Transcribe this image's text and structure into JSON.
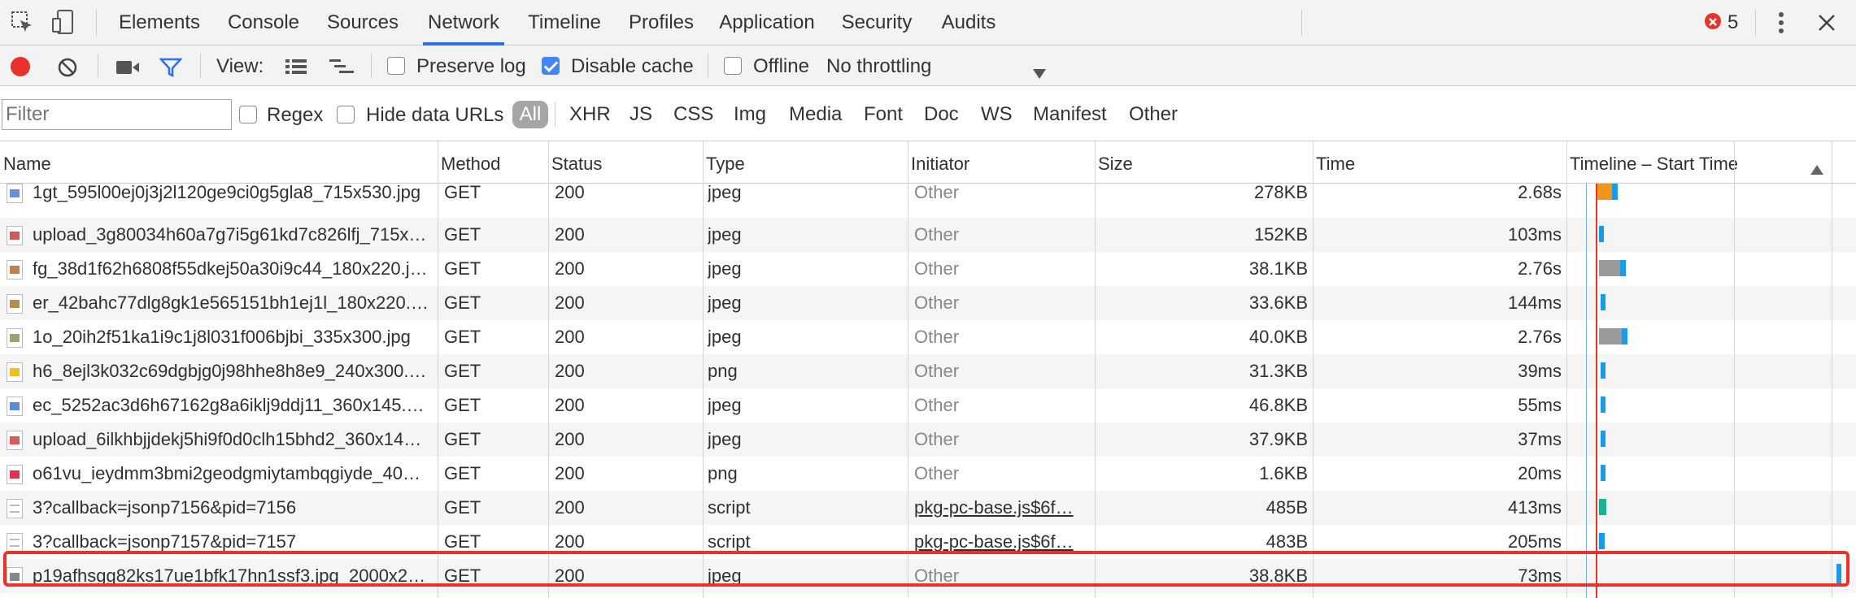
{
  "toolbar_tabs": [
    "Elements",
    "Console",
    "Sources",
    "Network",
    "Timeline",
    "Profiles",
    "Application",
    "Security",
    "Audits"
  ],
  "active_tab": "Network",
  "error_count": "5",
  "controls": {
    "view_label": "View:",
    "preserve_log": "Preserve log",
    "preserve_log_checked": false,
    "disable_cache": "Disable cache",
    "disable_cache_checked": true,
    "offline": "Offline",
    "offline_checked": false,
    "throttling": "No throttling"
  },
  "filter": {
    "placeholder": "Filter",
    "regex": "Regex",
    "hide_data_urls": "Hide data URLs",
    "types": [
      "All",
      "XHR",
      "JS",
      "CSS",
      "Img",
      "Media",
      "Font",
      "Doc",
      "WS",
      "Manifest",
      "Other"
    ]
  },
  "columns": [
    "Name",
    "Method",
    "Status",
    "Type",
    "Initiator",
    "Size",
    "Time",
    "Timeline – Start Time"
  ],
  "colors": {
    "accent": "#2c70ea",
    "record": "#e8322c",
    "highlight": "#e8322c",
    "bar_blue": "#1a9be8",
    "bar_orange": "#f0961c",
    "bar_gray": "#9a9a9a"
  },
  "rows": [
    {
      "name": "1gt_595l00ej0j3j2l120ge9ci0g5gla8_715x530.jpg",
      "method": "GET",
      "status": "200",
      "type": "jpeg",
      "initiator": "Other",
      "initiator_link": false,
      "size": "278KB",
      "time": "2.68s",
      "icon": "image-thumb-icon"
    },
    {
      "name": "upload_3g80034h60a7g7i5g61kd7c826lfj_715x…",
      "method": "GET",
      "status": "200",
      "type": "jpeg",
      "initiator": "Other",
      "initiator_link": false,
      "size": "152KB",
      "time": "103ms",
      "icon": "image-thumb-icon"
    },
    {
      "name": "fg_38d1f62h6808f55dkej50a30i9c44_180x220.j…",
      "method": "GET",
      "status": "200",
      "type": "jpeg",
      "initiator": "Other",
      "initiator_link": false,
      "size": "38.1KB",
      "time": "2.76s",
      "icon": "image-thumb-icon"
    },
    {
      "name": "er_42bahc77dlg8gk1e565151bh1ej1l_180x220.…",
      "method": "GET",
      "status": "200",
      "type": "jpeg",
      "initiator": "Other",
      "initiator_link": false,
      "size": "33.6KB",
      "time": "144ms",
      "icon": "image-thumb-icon"
    },
    {
      "name": "1o_20ih2f51ka1i9c1j8l031f006bjbi_335x300.jpg",
      "method": "GET",
      "status": "200",
      "type": "jpeg",
      "initiator": "Other",
      "initiator_link": false,
      "size": "40.0KB",
      "time": "2.76s",
      "icon": "image-thumb-icon"
    },
    {
      "name": "h6_8ejl3k032c69dgbjg0j98hhe8h8e9_240x300.…",
      "method": "GET",
      "status": "200",
      "type": "png",
      "initiator": "Other",
      "initiator_link": false,
      "size": "31.3KB",
      "time": "39ms",
      "icon": "image-thumb-icon"
    },
    {
      "name": "ec_5252ac3d6h67162g8a6iklj9ddj11_360x145.…",
      "method": "GET",
      "status": "200",
      "type": "jpeg",
      "initiator": "Other",
      "initiator_link": false,
      "size": "46.8KB",
      "time": "55ms",
      "icon": "image-thumb-icon"
    },
    {
      "name": "upload_6ilkhbjjdekj5hi9f0d0clh15bhd2_360x14…",
      "method": "GET",
      "status": "200",
      "type": "jpeg",
      "initiator": "Other",
      "initiator_link": false,
      "size": "37.9KB",
      "time": "37ms",
      "icon": "image-thumb-icon"
    },
    {
      "name": "o61vu_ieydmm3bmi2geodgmiytambqgiyde_40…",
      "method": "GET",
      "status": "200",
      "type": "png",
      "initiator": "Other",
      "initiator_link": false,
      "size": "1.6KB",
      "time": "20ms",
      "icon": "image-thumb-icon"
    },
    {
      "name": "3?callback=jsonp7156&pid=7156",
      "method": "GET",
      "status": "200",
      "type": "script",
      "initiator": "pkg-pc-base.js$6f…",
      "initiator_link": true,
      "size": "485B",
      "time": "413ms",
      "icon": "script-file-icon"
    },
    {
      "name": "3?callback=jsonp7157&pid=7157",
      "method": "GET",
      "status": "200",
      "type": "script",
      "initiator": "pkg-pc-base.js$6f…",
      "initiator_link": true,
      "size": "483B",
      "time": "205ms",
      "icon": "script-file-icon"
    },
    {
      "name": "p19afhsgg82ks17ue1bfk17hn1ssf3.jpg_2000x2…",
      "method": "GET",
      "status": "200",
      "type": "jpeg",
      "initiator": "Other",
      "initiator_link": false,
      "size": "38.8KB",
      "time": "73ms",
      "icon": "image-thumb-icon"
    }
  ]
}
